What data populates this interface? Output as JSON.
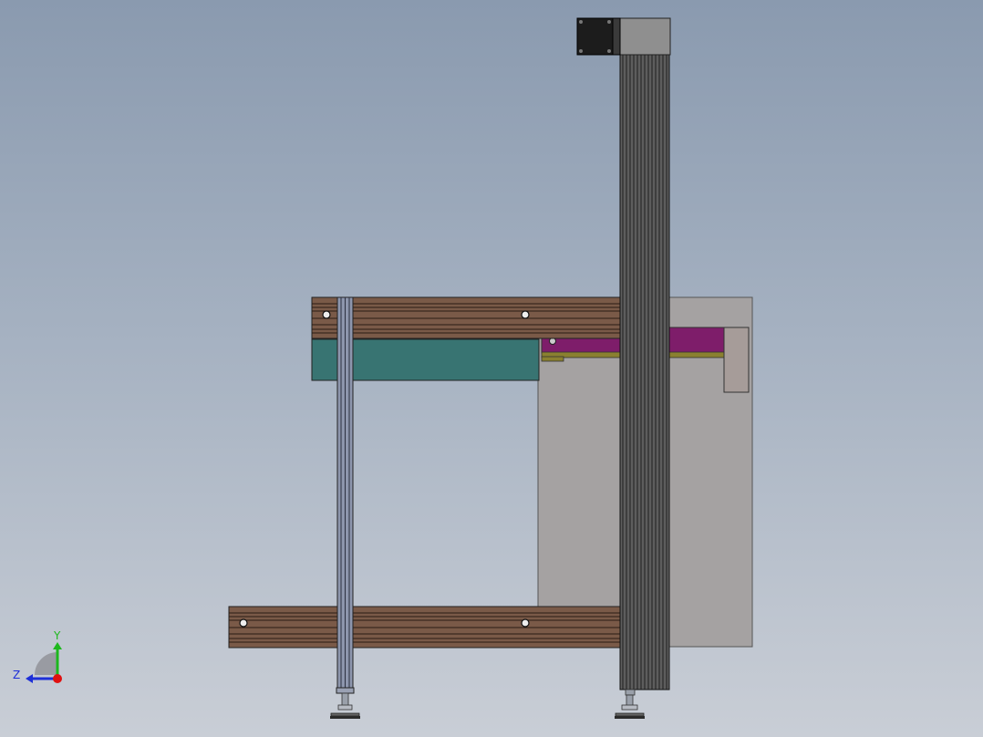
{
  "triad": {
    "y_label": "Y",
    "z_label": "Z",
    "y_color": "#1db81d",
    "z_color": "#1d2fd8",
    "x_color": "#e01010"
  },
  "colors": {
    "beam_wood": "#7a5a48",
    "panel_teal": "#387472",
    "panel_gray": "#a5a2a2",
    "rail_magenta": "#7e1d6a",
    "rail_olive": "#8a8030",
    "column_dark": "#5d5d5d",
    "rod_blue": "#8d96ad",
    "motor_black": "#1c1c1c",
    "motor_housing": "#8f8f8f"
  },
  "icons": {
    "axis_triad": "coordinate-triad-icon",
    "motor": "servo-motor-icon",
    "foot": "leveling-foot-icon"
  }
}
